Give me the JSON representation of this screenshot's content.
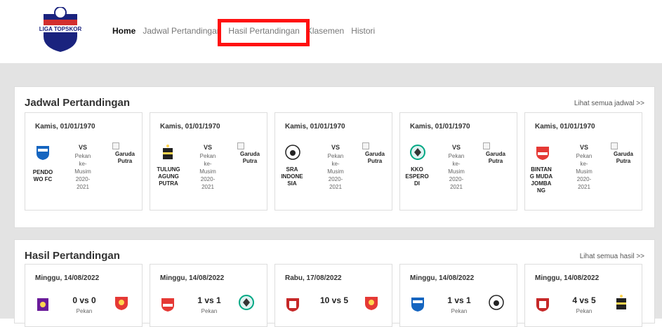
{
  "brand": {
    "logo_text": "LIGA TOPSKOR"
  },
  "nav": {
    "home": "Home",
    "jadwal": "Jadwal Pertandingan",
    "hasil": "Hasil Pertandingan",
    "klasemen": "Klasemen",
    "histori": "Histori"
  },
  "jadwal": {
    "title": "Jadwal Pertandingan",
    "link": "Lihat semua jadwal >>",
    "vs": "VS",
    "info_pekan": "Pekan",
    "info_ke": "ke-",
    "info_musim": "Musim",
    "info_season": "2020-2021",
    "away_broken_text": "Garuda Putra",
    "cards": [
      {
        "date": "Kamis, 01/01/1970",
        "home": "PENDO WO FC",
        "logo": "persipen-logo",
        "color": "#1565c0"
      },
      {
        "date": "Kamis, 01/01/1970",
        "home": "TULUNG AGUNG PUTRA",
        "logo": "tulungagung-logo",
        "color": "#222222"
      },
      {
        "date": "Kamis, 01/01/1970",
        "home": "SRA INDONE SIA",
        "logo": "sra-logo",
        "color": "#ffffff"
      },
      {
        "date": "Kamis, 01/01/1970",
        "home": "KKO ESPERO DI",
        "logo": "kko-logo",
        "color": "#00a884"
      },
      {
        "date": "Kamis, 01/01/1970",
        "home": "BINTAN G MUDA JOMBA NG",
        "logo": "bintang-muda-logo",
        "color": "#e53935"
      }
    ]
  },
  "hasil": {
    "title": "Hasil Pertandingan",
    "link": "Lihat semua hasil >>",
    "pekan_text": "Pekan",
    "cards": [
      {
        "date": "Minggu, 14/08/2022",
        "score": "0 vs 0",
        "home_color": "#6a1b9a",
        "away_color": "#e53935"
      },
      {
        "date": "Minggu, 14/08/2022",
        "score": "1 vs 1",
        "home_color": "#e53935",
        "away_color": "#00a884"
      },
      {
        "date": "Rabu, 17/08/2022",
        "score": "10 vs 5",
        "home_color": "#c62828",
        "away_color": "#e53935"
      },
      {
        "date": "Minggu, 14/08/2022",
        "score": "1 vs 1",
        "home_color": "#1565c0",
        "away_color": "#ffffff"
      },
      {
        "date": "Minggu, 14/08/2022",
        "score": "4 vs 5",
        "home_color": "#c62828",
        "away_color": "#222222"
      }
    ]
  }
}
